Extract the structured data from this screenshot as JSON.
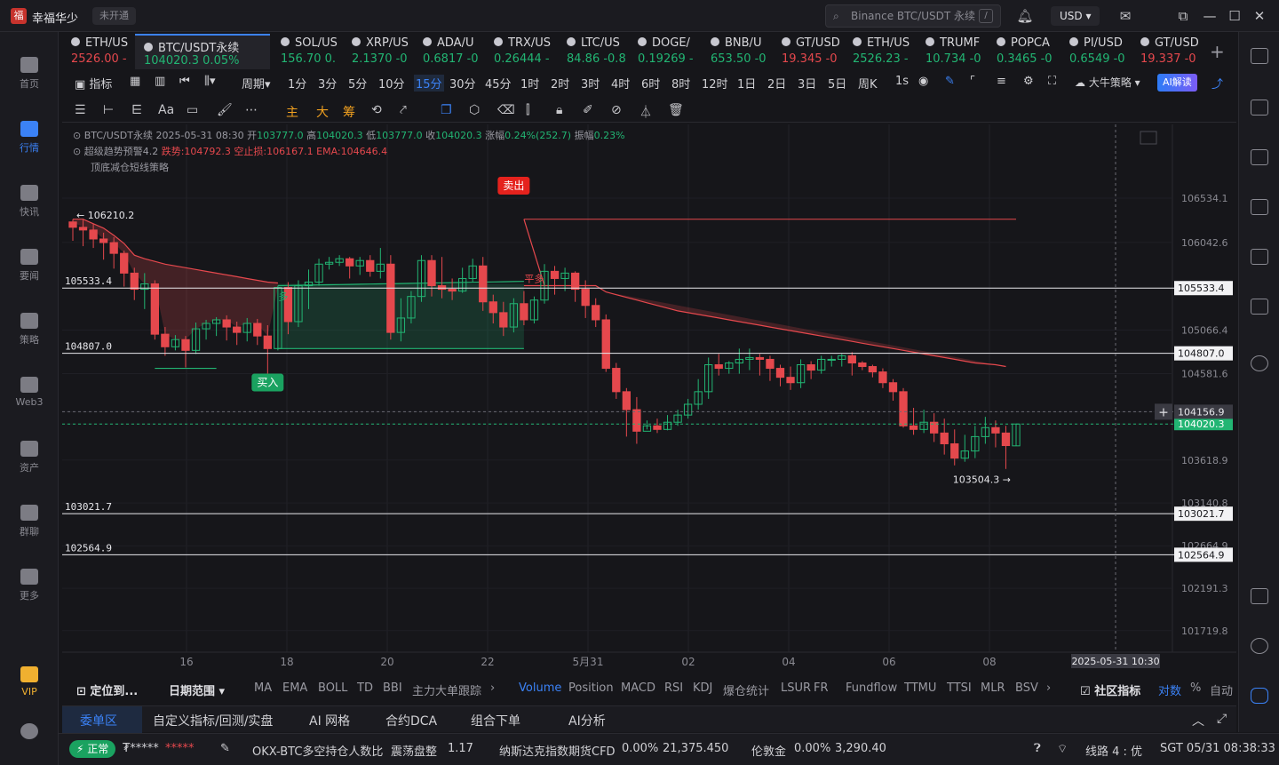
{
  "app": {
    "name": "幸福华少",
    "status": "未开通",
    "logo": "福"
  },
  "search": {
    "placeholder": "Binance BTC/USDT 永续",
    "shortcut": "/"
  },
  "currency": "USD ▾",
  "nav": [
    {
      "label": "首页",
      "icon": "home-icon"
    },
    {
      "label": "行情",
      "icon": "market-icon",
      "active": true
    },
    {
      "label": "快讯",
      "icon": "flash-news-icon"
    },
    {
      "label": "要闻",
      "icon": "news-icon"
    },
    {
      "label": "策略",
      "icon": "strategy-icon"
    },
    {
      "label": "Web3",
      "icon": "web3-icon"
    },
    {
      "label": "资产",
      "icon": "wallet-icon"
    },
    {
      "label": "群聊",
      "icon": "chat-icon"
    },
    {
      "label": "更多",
      "icon": "more-icon"
    },
    {
      "label": "VIP",
      "icon": "vip-icon"
    }
  ],
  "symbols": [
    {
      "name": "ETH/US",
      "price": "2526.00 -",
      "trend": "red"
    },
    {
      "name": "BTC/USDT永续",
      "price": "104020.3 0.05%",
      "trend": "green",
      "active": true
    },
    {
      "name": "SOL/US",
      "price": "156.70 0.",
      "trend": "green"
    },
    {
      "name": "XRP/US",
      "price": "2.1370 -0",
      "trend": "green"
    },
    {
      "name": "ADA/U",
      "price": "0.6817 -0",
      "trend": "green"
    },
    {
      "name": "TRX/US",
      "price": "0.26444 -",
      "trend": "green"
    },
    {
      "name": "LTC/US",
      "price": "84.86 -0.8",
      "trend": "green"
    },
    {
      "name": "DOGE/",
      "price": "0.19269 -",
      "trend": "green"
    },
    {
      "name": "BNB/U",
      "price": "653.50 -0",
      "trend": "green"
    },
    {
      "name": "GT/USD",
      "price": "19.345 -0",
      "trend": "red"
    },
    {
      "name": "ETH/US",
      "price": "2526.23 -",
      "trend": "green"
    },
    {
      "name": "TRUMF",
      "price": "10.734 -0",
      "trend": "green"
    },
    {
      "name": "POPCA",
      "price": "0.3465 -0",
      "trend": "green"
    },
    {
      "name": "PI/USD",
      "price": "0.6549 -0",
      "trend": "green"
    },
    {
      "name": "GT/USD",
      "price": "19.337 -0",
      "trend": "red"
    }
  ],
  "periods": {
    "indicator": "指标",
    "cycle": "周期",
    "items": [
      "1分",
      "3分",
      "5分",
      "10分",
      "15分",
      "30分",
      "45分",
      "1时",
      "2时",
      "3时",
      "4时",
      "6时",
      "8时",
      "12时",
      "1日",
      "2日",
      "3日",
      "5日",
      "周K"
    ],
    "active": "15分",
    "seconds": "1s",
    "strategy": "大牛策略",
    "ai": "AI解读"
  },
  "drawbar": {
    "main": "主",
    "big": "大",
    "chips": "筹",
    "font": "Aa"
  },
  "chart_info": {
    "line1": {
      "symbol": "BTC/USDT永续",
      "datetime": "2025-05-31 08:30",
      "open_label": "开",
      "open": "103777.0",
      "high_label": "高",
      "high": "104020.3",
      "low_label": "低",
      "low": "103777.0",
      "close_label": "收",
      "close": "104020.3",
      "chg_label": "涨幅",
      "chg": "0.24%(252.7)",
      "amp_label": "振幅",
      "amp": "0.23%"
    },
    "line2": {
      "name": "超级趋势预警4.2",
      "bear": "跌势:104792.3",
      "stop": "空止损:106167.1",
      "ema": "EMA:104646.4"
    },
    "line3": "顶底减仓短线策略"
  },
  "chart_data": {
    "type": "candlestick",
    "symbol": "BTC/USDT永续",
    "timeframe": "15分",
    "y_ticks": [
      "106534.1",
      "106042.6",
      "105533.4",
      "105066.4",
      "104807.0",
      "104581.6",
      "104156.9",
      "104020.3",
      "103618.9",
      "103140.8",
      "103021.7",
      "102664.9",
      "102564.9",
      "102191.3",
      "101719.8"
    ],
    "x_ticks": [
      "16",
      "18",
      "20",
      "22",
      "5月31",
      "02",
      "04",
      "06",
      "08"
    ],
    "ylim": [
      101520,
      106960
    ],
    "horizontal_levels": [
      {
        "value": 105533.4,
        "label": "105533.4"
      },
      {
        "value": 104807.0,
        "label": "104807.0"
      },
      {
        "value": 103021.7,
        "label": "103021.7"
      },
      {
        "value": 102564.9,
        "label": "102564.9"
      }
    ],
    "current_price": {
      "value": 104020.3,
      "label": "104020.3"
    },
    "crosshair": {
      "value": 104156.9,
      "label": "104156.9",
      "time": "2025-05-31 10:30"
    },
    "annotations": [
      {
        "text": "← 106210.2"
      },
      {
        "text": "103504.3 →"
      },
      {
        "text": "卖出",
        "type": "sell"
      },
      {
        "text": "买入",
        "type": "buy"
      },
      {
        "text": "多"
      },
      {
        "text": "平多"
      }
    ],
    "candles": [
      [
        106270,
        106210,
        106060,
        106300
      ],
      [
        106210,
        106180,
        106000,
        106300
      ],
      [
        106180,
        106080,
        105980,
        106250
      ],
      [
        106080,
        106040,
        105850,
        106150
      ],
      [
        106040,
        105920,
        105750,
        106100
      ],
      [
        105920,
        105700,
        105550,
        105950
      ],
      [
        105700,
        105520,
        105400,
        105760
      ],
      [
        105520,
        105580,
        105300,
        105700
      ],
      [
        105580,
        105020,
        104960,
        105620
      ],
      [
        105020,
        104880,
        104780,
        105100
      ],
      [
        104880,
        104960,
        104840,
        105010
      ],
      [
        104960,
        104840,
        104650,
        105000
      ],
      [
        104840,
        105080,
        104800,
        105150
      ],
      [
        105080,
        105140,
        104960,
        105180
      ],
      [
        105140,
        105180,
        105000,
        105210
      ],
      [
        105180,
        105100,
        104950,
        105230
      ],
      [
        105100,
        105040,
        104900,
        105160
      ],
      [
        105040,
        105140,
        104940,
        105200
      ],
      [
        105140,
        105000,
        104900,
        105190
      ],
      [
        105000,
        104860,
        104540,
        105120
      ],
      [
        104860,
        105540,
        104840,
        105560
      ],
      [
        105540,
        105160,
        105020,
        105600
      ],
      [
        105160,
        105560,
        105100,
        105620
      ],
      [
        105560,
        105600,
        105300,
        105740
      ],
      [
        105600,
        105800,
        105560,
        105860
      ],
      [
        105800,
        105820,
        105740,
        105880
      ],
      [
        105820,
        105860,
        105780,
        105900
      ],
      [
        105860,
        105780,
        105640,
        105880
      ],
      [
        105780,
        105840,
        105680,
        105880
      ],
      [
        105840,
        105720,
        105660,
        105900
      ],
      [
        105720,
        105800,
        105640,
        105980
      ],
      [
        105800,
        105040,
        104960,
        105900
      ],
      [
        105040,
        105200,
        104940,
        105420
      ],
      [
        105200,
        105440,
        105140,
        105500
      ],
      [
        105440,
        105840,
        105380,
        105900
      ],
      [
        105840,
        105560,
        105440,
        105900
      ],
      [
        105560,
        105520,
        105420,
        105880
      ],
      [
        105520,
        105500,
        105400,
        105640
      ],
      [
        105500,
        105640,
        105480,
        105760
      ],
      [
        105640,
        105780,
        105600,
        105860
      ],
      [
        105780,
        105380,
        105280,
        105880
      ],
      [
        105380,
        105260,
        105140,
        105460
      ],
      [
        105260,
        105100,
        105000,
        105380
      ],
      [
        105100,
        105360,
        105040,
        105420
      ],
      [
        105360,
        105180,
        105120,
        105500
      ],
      [
        105180,
        105400,
        105140,
        105440
      ],
      [
        105400,
        105720,
        105360,
        105800
      ],
      [
        105720,
        105640,
        105460,
        105780
      ],
      [
        105640,
        105700,
        105500,
        105760
      ],
      [
        105700,
        105520,
        105380,
        105720
      ],
      [
        105520,
        105340,
        105200,
        105620
      ],
      [
        105340,
        105180,
        105100,
        105420
      ],
      [
        105180,
        104640,
        104600,
        105240
      ],
      [
        104640,
        104380,
        104300,
        104700
      ],
      [
        104380,
        104180,
        103880,
        104420
      ],
      [
        104180,
        103940,
        103800,
        104320
      ],
      [
        103940,
        104000,
        103960,
        104060
      ],
      [
        104000,
        103960,
        103920,
        104080
      ],
      [
        103960,
        104040,
        103950,
        104120
      ],
      [
        104040,
        104120,
        104000,
        104180
      ],
      [
        104120,
        104240,
        104080,
        104300
      ],
      [
        104240,
        104380,
        104180,
        104520
      ],
      [
        104380,
        104680,
        104300,
        104760
      ],
      [
        104680,
        104640,
        104560,
        104800
      ],
      [
        104640,
        104700,
        104580,
        104720
      ],
      [
        104700,
        104740,
        104580,
        104860
      ],
      [
        104740,
        104760,
        104620,
        104860
      ],
      [
        104760,
        104740,
        104560,
        104800
      ],
      [
        104740,
        104640,
        104500,
        104780
      ],
      [
        104640,
        104540,
        104440,
        104680
      ],
      [
        104540,
        104480,
        104400,
        104660
      ],
      [
        104480,
        104680,
        104420,
        104740
      ],
      [
        104680,
        104620,
        104520,
        104720
      ],
      [
        104620,
        104740,
        104580,
        104780
      ],
      [
        104740,
        104740,
        104660,
        104780
      ],
      [
        104740,
        104780,
        104660,
        104800
      ],
      [
        104780,
        104700,
        104560,
        104820
      ],
      [
        104700,
        104660,
        104620,
        104720
      ],
      [
        104660,
        104600,
        104540,
        104680
      ],
      [
        104600,
        104480,
        104420,
        104640
      ],
      [
        104480,
        104380,
        104280,
        104520
      ],
      [
        104380,
        104000,
        103980,
        104420
      ],
      [
        104000,
        103960,
        103900,
        104200
      ],
      [
        103960,
        104040,
        103920,
        104180
      ],
      [
        104040,
        103920,
        103820,
        104140
      ],
      [
        103920,
        103800,
        103680,
        104080
      ],
      [
        103800,
        103640,
        103560,
        103960
      ],
      [
        103640,
        103720,
        103600,
        103900
      ],
      [
        103720,
        103880,
        103640,
        104000
      ],
      [
        103880,
        103980,
        103800,
        104100
      ],
      [
        103980,
        103920,
        103760,
        104060
      ],
      [
        103920,
        103780,
        103520,
        104000
      ],
      [
        103777,
        104020,
        103777,
        104020
      ]
    ],
    "supertrend": [
      106300,
      106300,
      106250,
      106200,
      106120,
      106030,
      105900,
      105860,
      105830,
      105800,
      105780,
      105760,
      105740,
      105720,
      105700,
      105680,
      105660,
      105640,
      105620,
      105600,
      105590,
      105580,
      105570,
      105560,
      105560,
      105560,
      105560,
      105560,
      105560,
      105560,
      105560,
      105560,
      105560,
      105560,
      105560,
      105560,
      105560,
      105560,
      105560,
      105560,
      105560,
      105560,
      105560,
      105560,
      105560,
      105560,
      105560,
      105560,
      105560,
      105560,
      105560,
      105560,
      105490,
      105460,
      105430,
      105400,
      105370,
      105340,
      105310,
      105280,
      105260,
      105240,
      105220,
      105200,
      105180,
      105160,
      105140,
      105120,
      105100,
      105080,
      105060,
      105040,
      105020,
      105000,
      104980,
      104960,
      104940,
      104920,
      104900,
      104880,
      104860,
      104840,
      104820,
      104800,
      104780,
      104760,
      104740,
      104720,
      104700,
      104690,
      104680,
      104660
    ]
  },
  "indicators": {
    "locate": "定位到...",
    "range": "日期范围",
    "items": [
      "MA",
      "EMA",
      "BOLL",
      "TD",
      "BBI",
      "主力大单跟踪"
    ],
    "sub": [
      "Volume",
      "Position",
      "MACD",
      "RSI",
      "KDJ",
      "爆仓统计",
      "LSUR",
      "FR",
      "Fundflow",
      "TTMU",
      "TTSI",
      "MLR",
      "BSV"
    ],
    "active": "Volume",
    "community": "社区指标",
    "log": "对数",
    "pct": "%",
    "auto": "自动"
  },
  "bottom_tabs": [
    "委单区",
    "自定义指标/回测/实盘",
    "AI 网格",
    "合约DCA",
    "组合下单",
    "AI分析"
  ],
  "statusbar": {
    "normal": "正常",
    "account": "₮*****",
    "masked": "*****",
    "ratio_name": "OKX-BTC多空持仓人数比",
    "ratio_state": "震荡盘整",
    "ratio_value": "1.17",
    "nasdaq_name": "纳斯达克指数期货CFD",
    "nasdaq_chg": "0.00%",
    "nasdaq_value": "21,375.450",
    "gold_name": "伦敦金",
    "gold_chg": "0.00%",
    "gold_value": "3,290.40",
    "line": "线路 4 : 优",
    "time": "SGT 05/31 08:38:33"
  },
  "colors": {
    "up": "#22b573",
    "down": "#e5484d",
    "accent": "#3b82f6",
    "bg": "#16161a"
  }
}
